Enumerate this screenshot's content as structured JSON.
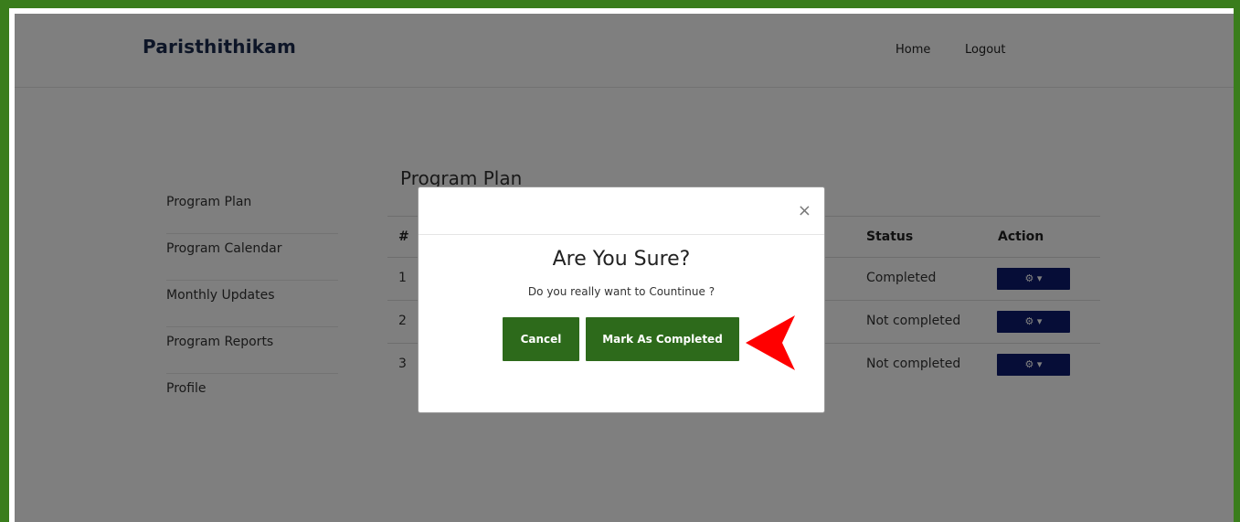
{
  "navbar": {
    "brand": "Paristhithikam",
    "links": [
      {
        "label": "Home"
      },
      {
        "label": "Logout"
      }
    ]
  },
  "sidebar": {
    "items": [
      {
        "label": "Program Plan"
      },
      {
        "label": "Program Calendar"
      },
      {
        "label": "Monthly Updates"
      },
      {
        "label": "Program Reports"
      },
      {
        "label": "Profile"
      }
    ]
  },
  "content": {
    "title": "Program Plan",
    "table": {
      "headers": {
        "num": "#",
        "status": "Status",
        "action": "Action"
      },
      "rows": [
        {
          "num": "1",
          "status": "Completed"
        },
        {
          "num": "2",
          "status": "Not completed"
        },
        {
          "num": "3",
          "status": "Not completed"
        }
      ]
    }
  },
  "modal": {
    "close": "×",
    "title": "Are You Sure?",
    "text": "Do you really want to Countinue ?",
    "cancel_label": "Cancel",
    "confirm_label": "Mark As Completed"
  },
  "icons": {
    "action": "gear-icon",
    "dropdown": "caret-down-icon",
    "annotation": "red-arrow-icon"
  },
  "colors": {
    "frame_border": "#3a7d1c",
    "brand_text": "#1b2a4e",
    "action_button": "#0d1b6e",
    "modal_button": "#2d6a1b",
    "annotation_arrow": "#ff0000"
  }
}
